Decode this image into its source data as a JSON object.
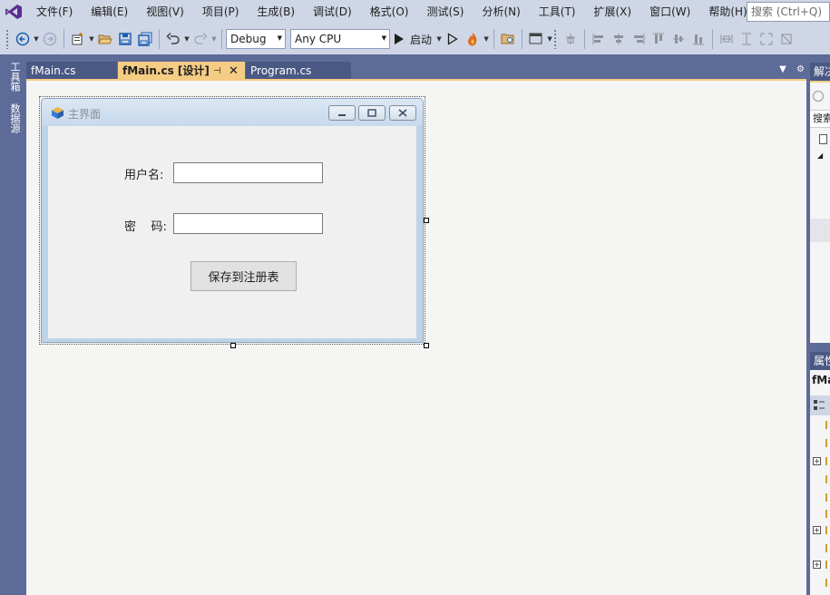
{
  "menubar": {
    "items": [
      "文件(F)",
      "编辑(E)",
      "视图(V)",
      "项目(P)",
      "生成(B)",
      "调试(D)",
      "格式(O)",
      "测试(S)",
      "分析(N)",
      "工具(T)",
      "扩展(X)",
      "窗口(W)",
      "帮助(H)"
    ],
    "search_placeholder": "搜索 (Ctrl+Q)"
  },
  "toolbar": {
    "configuration": "Debug",
    "platform": "Any CPU",
    "start_label": "启动"
  },
  "left_strip": {
    "toolbox": "工具箱",
    "datasources": "数据源"
  },
  "tabs": [
    {
      "label": "fMain.cs",
      "active": false
    },
    {
      "label": "fMain.cs [设计]",
      "active": true
    },
    {
      "label": "Program.cs",
      "active": false
    }
  ],
  "form": {
    "title": "主界面",
    "username_label": "用户名:",
    "password_label": "密    码:",
    "save_button": "保存到注册表"
  },
  "right_panels": {
    "solution_title": "解决方案资源管理器",
    "solution_search": "搜索解决方案资源管理器",
    "properties_title": "属性",
    "properties_object": "fMain"
  }
}
